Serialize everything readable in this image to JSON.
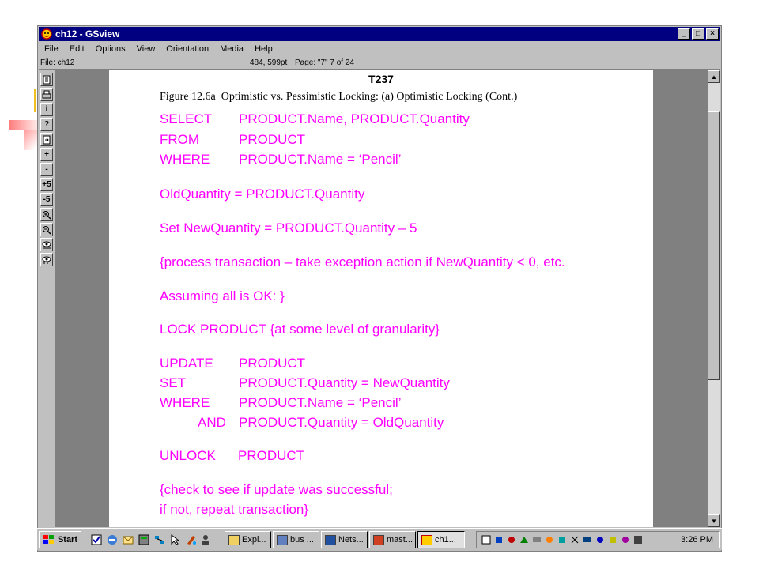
{
  "window": {
    "title": "ch12 - GSview",
    "buttons": {
      "minimize": "_",
      "maximize": "□",
      "close": "×"
    }
  },
  "menu": [
    "File",
    "Edit",
    "Options",
    "View",
    "Orientation",
    "Media",
    "Help"
  ],
  "status": {
    "file": "File: ch12",
    "coords": "484, 599pt",
    "page": "Page: \"7\"  7 of 24"
  },
  "toolbar": {
    "info": "i",
    "help": "?",
    "zoom_in": "+",
    "zoom_out": "-",
    "plus5": "+5",
    "minus5": "-5"
  },
  "document": {
    "page_label": "T237",
    "caption_bold": "Figure 12.6a",
    "caption_text": "Optimistic vs. Pessimistic Locking: (a) Optimistic Locking (Cont.)",
    "select_kw": "SELECT",
    "select_val": "PRODUCT.Name, PRODUCT.Quantity",
    "from_kw": "FROM",
    "from_val": "PRODUCT",
    "where_kw": "WHERE",
    "where_val": "PRODUCT.Name = ‘Pencil’",
    "old_quantity": "OldQuantity = PRODUCT.Quantity",
    "set_new": "Set NewQuantity = PRODUCT.Quantity – 5",
    "process": "{process transaction – take exception action if NewQuantity < 0, etc.",
    "assuming": "Assuming all is OK: }",
    "lock": "LOCK PRODUCT {at some level of granularity}",
    "update_kw": "UPDATE",
    "update_val": "PRODUCT",
    "set_kw": "SET",
    "set_val": "PRODUCT.Quantity = NewQuantity",
    "where2_kw": "WHERE",
    "where2_val": "PRODUCT.Name = ‘Pencil’",
    "and_kw": "AND",
    "and_val": "PRODUCT.Quantity = OldQuantity",
    "unlock_kw": "UNLOCK",
    "unlock_val": "PRODUCT",
    "check1": "{check to see if update was successful;",
    "check2": "if not, repeat transaction}"
  },
  "taskbar": {
    "start": "Start",
    "tasks": [
      "Expl...",
      "bus ...",
      "Nets...",
      "mast...",
      "ch1..."
    ],
    "clock": "3:26 PM"
  },
  "colors": {
    "sql_text": "#ff00ff",
    "titlebar": "#000080"
  }
}
